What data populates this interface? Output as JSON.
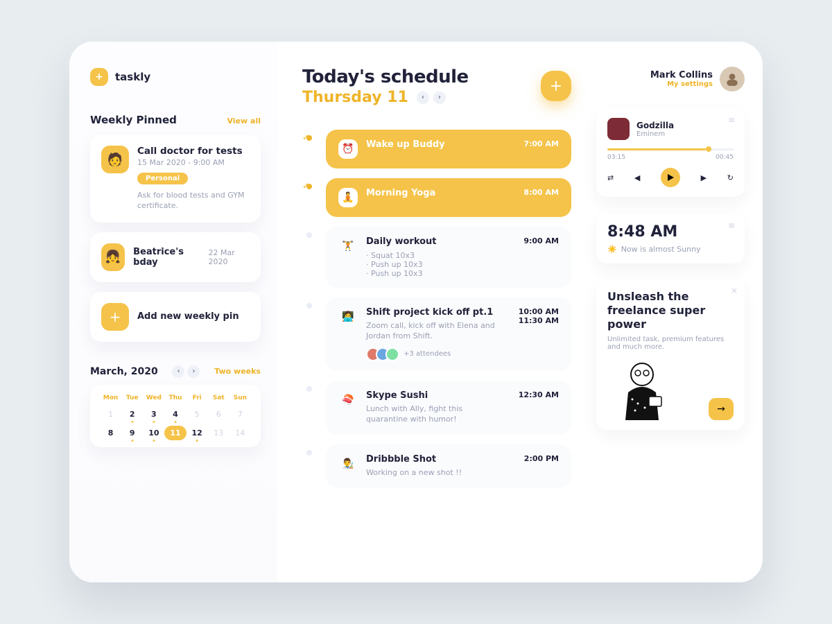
{
  "brand": {
    "name": "taskly"
  },
  "pinned": {
    "title": "Weekly Pinned",
    "view_all": "View all",
    "add_label": "Add new weekly pin",
    "items": [
      {
        "title": "Call doctor for tests",
        "date": "15 Mar 2020 - 9:00 AM",
        "badge": "Personal",
        "note": "Ask for blood tests and GYM certificate."
      },
      {
        "title": "Beatrice's bday",
        "date": "22 Mar 2020"
      }
    ]
  },
  "calendar": {
    "month": "March, 2020",
    "range_label": "Two weeks",
    "dow": [
      "Mon",
      "Tue",
      "Wed",
      "Thu",
      "Fri",
      "Sat",
      "Sun"
    ],
    "days": [
      "1",
      "2",
      "3",
      "4",
      "5",
      "6",
      "7",
      "8",
      "9",
      "10",
      "11",
      "12",
      "13",
      "14"
    ]
  },
  "schedule": {
    "title": "Today's schedule",
    "date": "Thursday 11",
    "items": [
      {
        "title": "Wake up Buddy",
        "time": "7:00 AM"
      },
      {
        "title": "Morning Yoga",
        "time": "8:00 AM"
      },
      {
        "title": "Daily workout",
        "time": "9:00 AM",
        "sub": [
          "Squat 10x3",
          "Push up 10x3",
          "Push up 10x3"
        ]
      },
      {
        "title": "Shift project kick off pt.1",
        "time": "10:00 AM",
        "time2": "11:30 AM",
        "desc": "Zoom call, kick off with Elena and Jordan from Shift.",
        "attendees": "+3 attendees"
      },
      {
        "title": "Skype Sushi",
        "time": "12:30 AM",
        "desc": "Lunch with Ally, fight this quarantine with humor!"
      },
      {
        "title": "Dribbble Shot",
        "time": "2:00 PM",
        "desc": "Working on a new shot !!"
      }
    ]
  },
  "user": {
    "name": "Mark Collins",
    "settings": "My settings"
  },
  "music": {
    "song": "Godzilla",
    "artist": "Eminem",
    "elapsed": "03:15",
    "remaining": "00:45"
  },
  "clock": {
    "time": "8:48 AM",
    "weather": "Now is almost Sunny"
  },
  "promo": {
    "title": "Unsleash the freelance super power",
    "desc": "Unlimited task, premium features and much more."
  }
}
